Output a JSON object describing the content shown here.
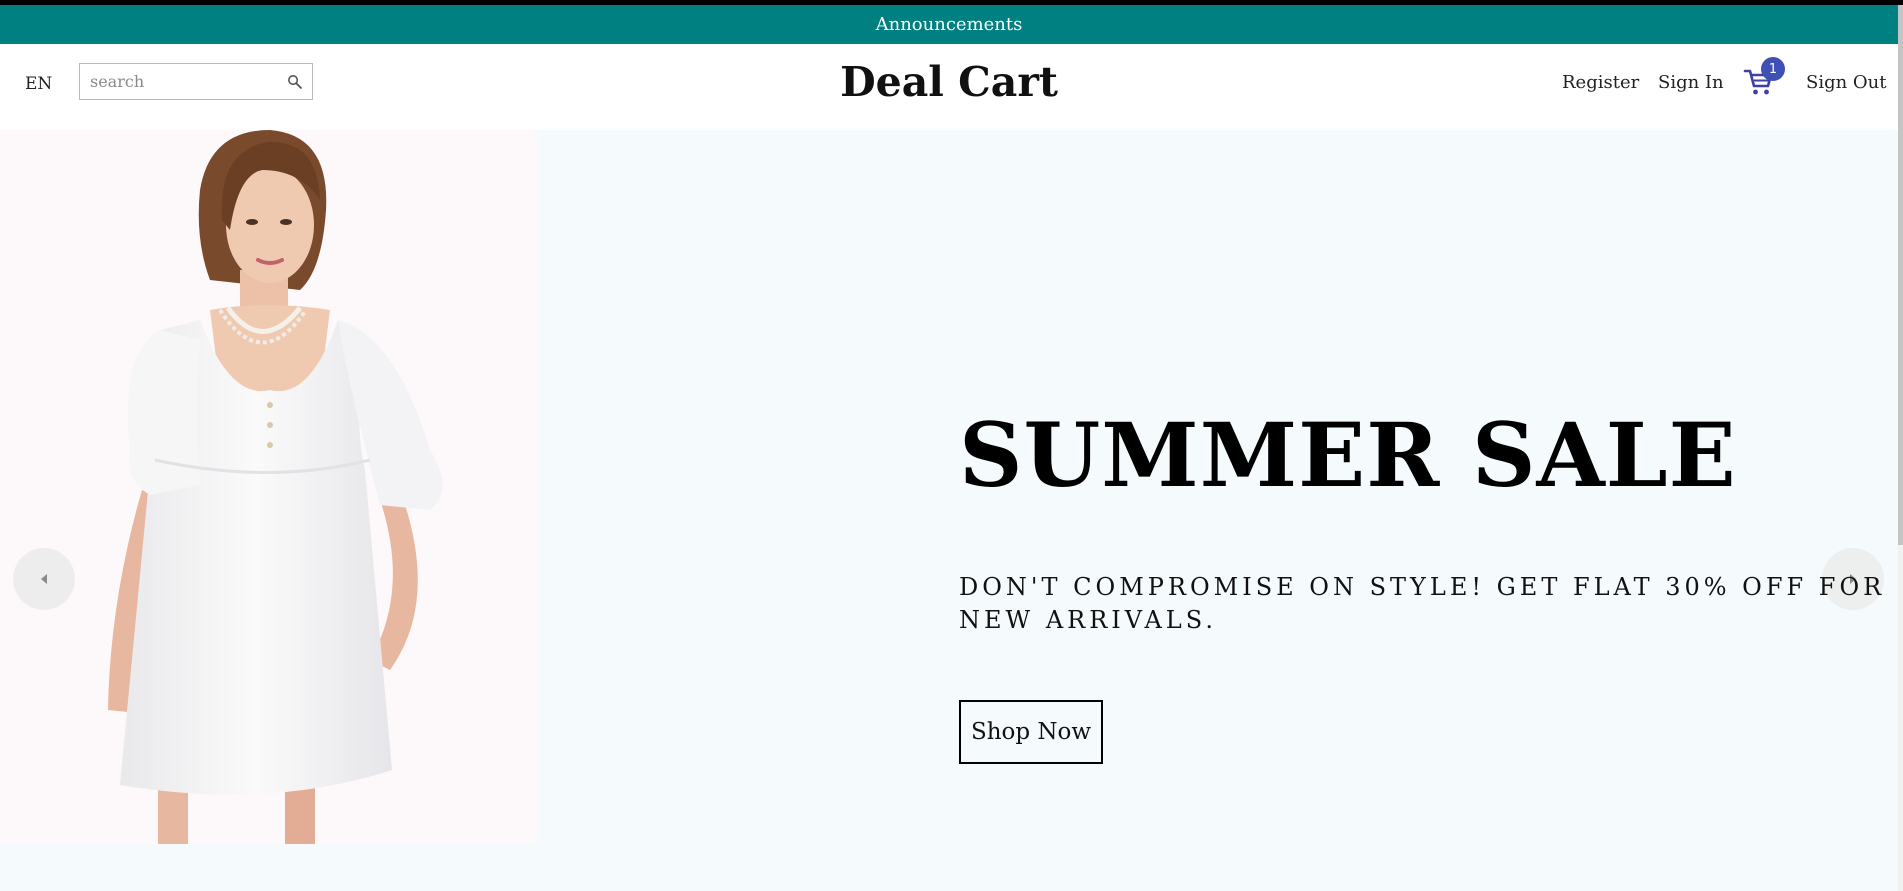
{
  "announcement": {
    "text": "Announcements"
  },
  "header": {
    "language": "EN",
    "search": {
      "placeholder": "search",
      "value": ""
    },
    "logo": "Deal Cart",
    "nav": {
      "register": "Register",
      "sign_in": "Sign In",
      "sign_out": "Sign Out"
    },
    "cart": {
      "icon": "cart-icon",
      "count": "1"
    }
  },
  "hero": {
    "title": "SUMMER SALE",
    "description": "DON'T COMPROMISE ON STYLE! GET FLAT 30% OFF FOR NEW ARRIVALS.",
    "button": "Shop Now",
    "image": "woman-in-white-dress"
  },
  "colors": {
    "announcement_bg": "#008080",
    "badge": "#3f51b5",
    "cart_icon": "#3f3fa6",
    "hero_bg": "#f5fafd"
  }
}
